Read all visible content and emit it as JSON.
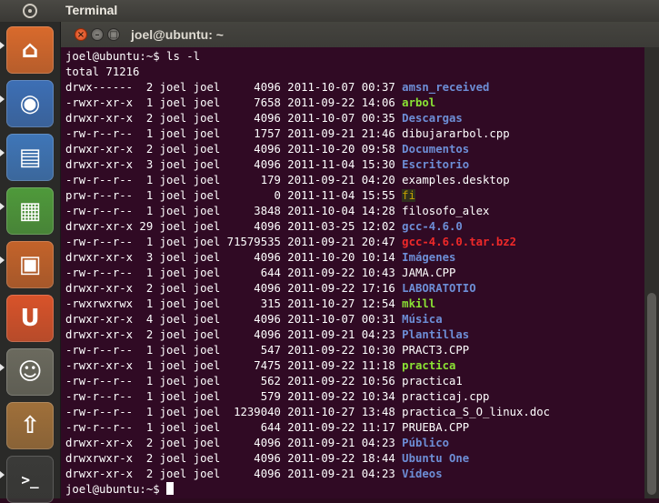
{
  "top_panel": {
    "title": "Terminal",
    "logo_icon": "ubuntu-logo-icon"
  },
  "launcher": {
    "items": [
      {
        "name": "home-folder",
        "icon": "folder-home-icon",
        "color": "#d96a2c",
        "glyph": "⌂"
      },
      {
        "name": "firefox",
        "icon": "firefox-icon",
        "color": "#3d6fb5",
        "glyph": "◉"
      },
      {
        "name": "libreoffice-writer",
        "icon": "writer-icon",
        "color": "#3f76b8",
        "glyph": "▤"
      },
      {
        "name": "libreoffice-calc",
        "icon": "calc-icon",
        "color": "#4f9a3b",
        "glyph": "▦"
      },
      {
        "name": "libreoffice-impress",
        "icon": "impress-icon",
        "color": "#c4632a",
        "glyph": "▣"
      },
      {
        "name": "ubuntu-software-center",
        "icon": "software-center-icon",
        "color": "#d9532a",
        "glyph": "U"
      },
      {
        "name": "ubuntu-one",
        "icon": "users-icon",
        "color": "#6b6a5e",
        "glyph": "☺"
      },
      {
        "name": "archive-manager",
        "icon": "archive-icon",
        "color": "#a0703a",
        "glyph": "⇧"
      },
      {
        "name": "terminal",
        "icon": "terminal-icon",
        "color": "#3a3a38",
        "glyph": ">_"
      }
    ]
  },
  "window": {
    "title": "joel@ubuntu: ~",
    "close_label": "×",
    "min_label": "–",
    "max_label": "□"
  },
  "terminal": {
    "prompt_line": "joel@ubuntu:~$ ls -l",
    "total_line": "total 71216",
    "entries": [
      {
        "meta": "drwx------  2 joel joel     4096 2011-10-07 00:37 ",
        "name": "amsn_received",
        "type": "dir"
      },
      {
        "meta": "-rwxr-xr-x  1 joel joel     7658 2011-09-22 14:06 ",
        "name": "arbol",
        "type": "exec"
      },
      {
        "meta": "drwxr-xr-x  2 joel joel     4096 2011-10-07 00:35 ",
        "name": "Descargas",
        "type": "dir"
      },
      {
        "meta": "-rw-r--r--  1 joel joel     1757 2011-09-21 21:46 ",
        "name": "dibujararbol.cpp",
        "type": "file"
      },
      {
        "meta": "drwxr-xr-x  2 joel joel     4096 2011-10-20 09:58 ",
        "name": "Documentos",
        "type": "dir"
      },
      {
        "meta": "drwxr-xr-x  3 joel joel     4096 2011-11-04 15:30 ",
        "name": "Escritorio",
        "type": "dir"
      },
      {
        "meta": "-rw-r--r--  1 joel joel      179 2011-09-21 04:20 ",
        "name": "examples.desktop",
        "type": "file"
      },
      {
        "meta": "prw-r--r--  1 joel joel        0 2011-11-04 15:55 ",
        "name": "fi",
        "type": "pipe"
      },
      {
        "meta": "-rw-r--r--  1 joel joel     3848 2011-10-04 14:28 ",
        "name": "filosofo_alex",
        "type": "file"
      },
      {
        "meta": "drwxr-xr-x 29 joel joel     4096 2011-03-25 12:02 ",
        "name": "gcc-4.6.0",
        "type": "dir"
      },
      {
        "meta": "-rw-r--r--  1 joel joel 71579535 2011-09-21 20:47 ",
        "name": "gcc-4.6.0.tar.bz2",
        "type": "archive"
      },
      {
        "meta": "drwxr-xr-x  3 joel joel     4096 2011-10-20 10:14 ",
        "name": "Imágenes",
        "type": "dir"
      },
      {
        "meta": "-rw-r--r--  1 joel joel      644 2011-09-22 10:43 ",
        "name": "JAMA.CPP",
        "type": "file"
      },
      {
        "meta": "drwxr-xr-x  2 joel joel     4096 2011-09-22 17:16 ",
        "name": "LABORATOTIO",
        "type": "dir"
      },
      {
        "meta": "-rwxrwxrwx  1 joel joel      315 2011-10-27 12:54 ",
        "name": "mkill",
        "type": "exec"
      },
      {
        "meta": "drwxr-xr-x  4 joel joel     4096 2011-10-07 00:31 ",
        "name": "Música",
        "type": "dir"
      },
      {
        "meta": "drwxr-xr-x  2 joel joel     4096 2011-09-21 04:23 ",
        "name": "Plantillas",
        "type": "dir"
      },
      {
        "meta": "-rw-r--r--  1 joel joel      547 2011-09-22 10:30 ",
        "name": "PRACT3.CPP",
        "type": "file"
      },
      {
        "meta": "-rwxr-xr-x  1 joel joel     7475 2011-09-22 11:18 ",
        "name": "practica",
        "type": "exec"
      },
      {
        "meta": "-rw-r--r--  1 joel joel      562 2011-09-22 10:56 ",
        "name": "practica1",
        "type": "file"
      },
      {
        "meta": "-rw-r--r--  1 joel joel      579 2011-09-22 10:34 ",
        "name": "practicaj.cpp",
        "type": "file"
      },
      {
        "meta": "-rw-r--r--  1 joel joel  1239040 2011-10-27 13:48 ",
        "name": "practica_S_O_linux.doc",
        "type": "file"
      },
      {
        "meta": "-rw-r--r--  1 joel joel      644 2011-09-22 11:17 ",
        "name": "PRUEBA.CPP",
        "type": "file"
      },
      {
        "meta": "drwxr-xr-x  2 joel joel     4096 2011-09-21 04:23 ",
        "name": "Público",
        "type": "dir"
      },
      {
        "meta": "drwxrwxr-x  2 joel joel     4096 2011-09-22 18:44 ",
        "name": "Ubuntu One",
        "type": "dir"
      },
      {
        "meta": "drwxr-xr-x  2 joel joel     4096 2011-09-21 04:23 ",
        "name": "Vídeos",
        "type": "dir"
      }
    ],
    "final_prompt": "joel@ubuntu:~$ "
  },
  "colors": {
    "terminal_bg": "#300a24",
    "dir": "#6d8ed6",
    "exec": "#8ae234",
    "archive": "#ef2929",
    "pipe": "#c4a000"
  }
}
